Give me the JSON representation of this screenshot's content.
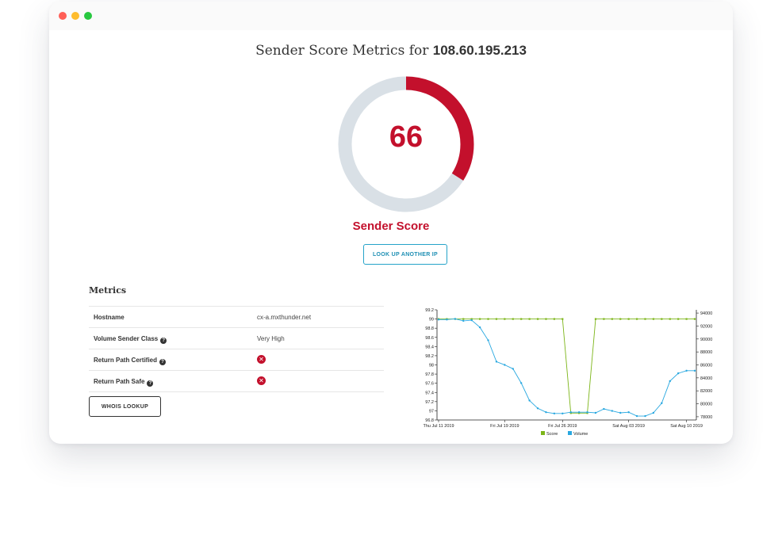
{
  "window": {
    "controls": [
      "close",
      "minimize",
      "zoom"
    ]
  },
  "header": {
    "title_prefix": "Sender Score Metrics for",
    "ip": "108.60.195.213"
  },
  "score": {
    "value": "66",
    "value_fraction": 0.34,
    "label": "Sender Score",
    "accent_color": "#c3102c",
    "track_color": "#d9e0e6"
  },
  "buttons": {
    "lookup_another_ip": "LOOK UP ANOTHER IP",
    "whois_lookup": "WHOIS LOOKUP"
  },
  "metrics": {
    "heading": "Metrics",
    "rows": [
      {
        "label": "Hostname",
        "value": "cx-a.mxthunder.net",
        "help": false,
        "status_icon": null
      },
      {
        "label": "Volume Sender Class",
        "value": "Very High",
        "help": true,
        "status_icon": null
      },
      {
        "label": "Return Path Certified",
        "value": "",
        "help": true,
        "status_icon": "x-circle-icon"
      },
      {
        "label": "Return Path Safe",
        "value": "",
        "help": true,
        "status_icon": "x-circle-icon"
      }
    ]
  },
  "chart_data": {
    "type": "line",
    "title": "",
    "x_tick_labels": [
      "Thu Jul 11 2019",
      "Fri Jul 19 2019",
      "Fri Jul 26 2019",
      "Sat Aug 03 2019",
      "Sat Aug 10 2019"
    ],
    "x": [
      "Jul 11",
      "Jul 12",
      "Jul 13",
      "Jul 14",
      "Jul 15",
      "Jul 16",
      "Jul 17",
      "Jul 18",
      "Jul 19",
      "Jul 20",
      "Jul 21",
      "Jul 22",
      "Jul 23",
      "Jul 24",
      "Jul 25",
      "Jul 26",
      "Jul 27",
      "Jul 28",
      "Jul 29",
      "Jul 30",
      "Jul 31",
      "Aug 01",
      "Aug 02",
      "Aug 03",
      "Aug 04",
      "Aug 05",
      "Aug 06",
      "Aug 07",
      "Aug 08",
      "Aug 09",
      "Aug 10",
      "Aug 11"
    ],
    "y_left_ticks": [
      "96.8",
      "97",
      "97.2",
      "97.4",
      "97.6",
      "97.8",
      "98",
      "98.2",
      "98.4",
      "98.6",
      "98.8",
      "99",
      "99.2"
    ],
    "y_left_range": [
      96.8,
      99.2
    ],
    "y_right_ticks": [
      "78000",
      "80000",
      "82000",
      "84000",
      "86000",
      "88000",
      "90000",
      "92000",
      "94000"
    ],
    "y_right_range": [
      77500,
      94500
    ],
    "series": [
      {
        "name": "Score",
        "axis": "left",
        "color": "#7cb518",
        "values": [
          99,
          99,
          99,
          99,
          99,
          99,
          99,
          99,
          99,
          99,
          99,
          99,
          99,
          99,
          99,
          99,
          96.95,
          96.95,
          96.95,
          99,
          99,
          99,
          99,
          99,
          99,
          99,
          99,
          99,
          99,
          99,
          99,
          99
        ]
      },
      {
        "name": "Volume",
        "axis": "right",
        "color": "#29a8e0",
        "values": [
          93000,
          93000,
          93100,
          92800,
          92900,
          91800,
          89800,
          86500,
          86000,
          85400,
          83200,
          80500,
          79300,
          78700,
          78500,
          78500,
          78700,
          78700,
          78700,
          78600,
          79200,
          78900,
          78600,
          78700,
          78100,
          78100,
          78600,
          80100,
          83500,
          84700,
          85100,
          85100
        ]
      }
    ],
    "legend_placement": "bottom",
    "grid": false
  }
}
